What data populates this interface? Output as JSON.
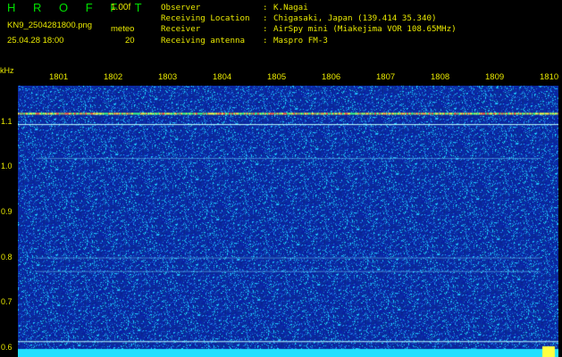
{
  "header": {
    "logo": "H R O F F T",
    "version": "1.00f",
    "filename": "KN9_2504281800.png",
    "meteo_label": "meteo",
    "datetime": "25.04.28 18:00",
    "meteo_value": "20"
  },
  "info": [
    {
      "label": "Observer",
      "value": "K.Nagai"
    },
    {
      "label": "Receiving Location",
      "value": "Chigasaki, Japan (139.414 35.340)"
    },
    {
      "label": "Receiver",
      "value": "AirSpy mini (Miakejima VOR 108.65MHz)"
    },
    {
      "label": "Receiving antenna",
      "value": "Maspro FM-3"
    }
  ],
  "chart_data": {
    "type": "heatmap",
    "ylabel": "kHz",
    "y_ticks": [
      "1.1",
      "1.0",
      "0.9",
      "0.8",
      "0.7",
      "0.6"
    ],
    "y_tick_values": [
      1.1,
      1.0,
      0.9,
      0.8,
      0.7,
      0.6
    ],
    "x_ticks": [
      "1801",
      "1802",
      "1803",
      "1804",
      "1805",
      "1806",
      "1807",
      "1808",
      "1809",
      "1810"
    ],
    "ylim": [
      0.58,
      1.18
    ],
    "colors": {
      "background": "#0a1a9a",
      "noise": "#40c0ff",
      "signal": "#ffff40",
      "bottom_band": "#20e0ff"
    }
  }
}
